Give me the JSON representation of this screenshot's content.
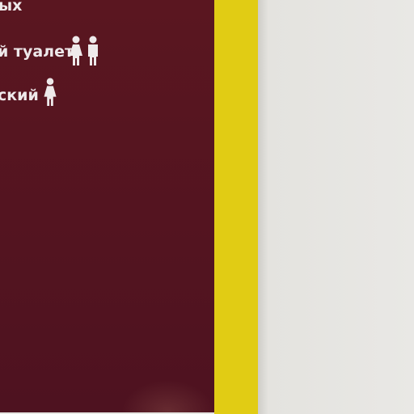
{
  "sign": {
    "lines": [
      "ых",
      "й туалет",
      "ский"
    ],
    "icons": [
      "woman-icon",
      "man-icon",
      "woman-icon"
    ]
  },
  "colors": {
    "sign": "#561520",
    "frame": "#e1cc14",
    "wall": "#e6e5e1",
    "text": "#eee9ea"
  }
}
